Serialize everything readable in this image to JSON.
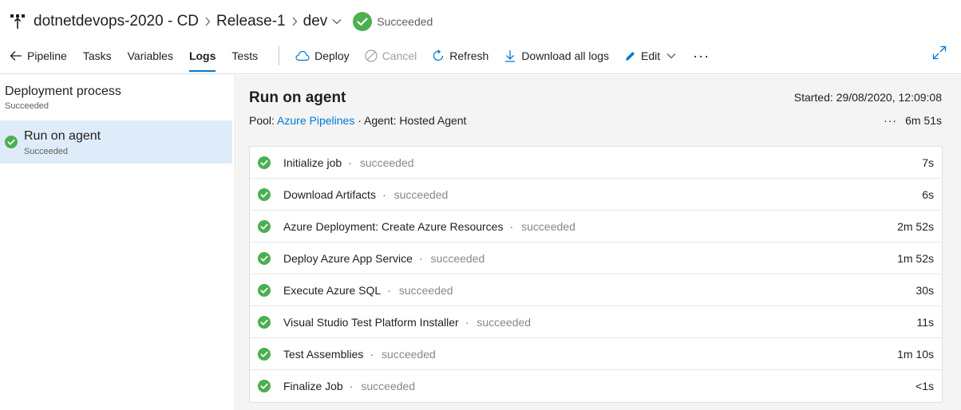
{
  "breadcrumb": {
    "pipeline": "dotnetdevops-2020 - CD",
    "release": "Release-1",
    "stage": "dev",
    "status": "Succeeded"
  },
  "toolbar": {
    "back_label": "Pipeline",
    "tabs": [
      "Tasks",
      "Variables",
      "Logs",
      "Tests"
    ],
    "active_tab": "Logs",
    "actions": {
      "deploy": "Deploy",
      "cancel": "Cancel",
      "refresh": "Refresh",
      "download": "Download all logs",
      "edit": "Edit"
    }
  },
  "left_panel": {
    "title": "Deployment process",
    "status": "Succeeded",
    "item": {
      "title": "Run on agent",
      "status": "Succeeded"
    }
  },
  "run": {
    "title": "Run on agent",
    "started_label": "Started: 29/08/2020, 12:09:08",
    "pool_label": "Pool:",
    "pool_name": "Azure Pipelines",
    "agent_label": "Agent: Hosted Agent",
    "separator": "·",
    "duration": "6m 51s"
  },
  "jobs": [
    {
      "name": "Initialize job",
      "status": "succeeded",
      "time": "7s"
    },
    {
      "name": "Download Artifacts",
      "status": "succeeded",
      "time": "6s"
    },
    {
      "name": "Azure Deployment: Create Azure Resources",
      "status": "succeeded",
      "time": "2m 52s"
    },
    {
      "name": "Deploy Azure App Service",
      "status": "succeeded",
      "time": "1m 52s"
    },
    {
      "name": "Execute Azure SQL",
      "status": "succeeded",
      "time": "30s"
    },
    {
      "name": "Visual Studio Test Platform Installer",
      "status": "succeeded",
      "time": "11s"
    },
    {
      "name": "Test Assemblies",
      "status": "succeeded",
      "time": "1m 10s"
    },
    {
      "name": "Finalize Job",
      "status": "succeeded",
      "time": "<1s"
    }
  ],
  "colors": {
    "success": "#4caf50",
    "accent": "#0078d4",
    "selected": "#deecf9",
    "content_bg": "#f4f4f4"
  },
  "icons": {
    "logo": "release-pipeline-icon",
    "status": "check-circle-icon",
    "back": "arrow-left-icon",
    "deploy": "cloud-icon",
    "cancel": "cancel-icon",
    "refresh": "refresh-icon",
    "download": "download-icon",
    "edit": "pencil-icon",
    "more": "more-horizontal-icon",
    "expand": "expand-icon"
  }
}
